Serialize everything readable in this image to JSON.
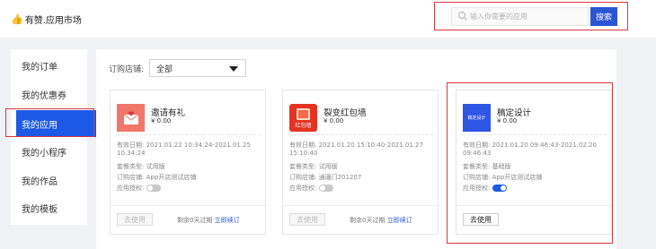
{
  "header": {
    "logo_text": "有赞.应用市场",
    "search_placeholder": "输入你需要的应用",
    "search_button": "搜索"
  },
  "sidebar": {
    "items": [
      {
        "label": "我的订单",
        "active": false
      },
      {
        "label": "我的优惠券",
        "active": false
      },
      {
        "label": "我的应用",
        "active": true
      },
      {
        "label": "我的小程序",
        "active": false
      },
      {
        "label": "我的作品",
        "active": false
      },
      {
        "label": "我的模板",
        "active": false
      }
    ]
  },
  "filter": {
    "label": "订购店铺:",
    "selected": "全部"
  },
  "cards": [
    {
      "name": "邀请有礼",
      "price": "¥ 0.00",
      "valid_label": "有效日期:",
      "valid_value": "2021.01.22 10:34:24-2021.01.25 10:34:24",
      "plan_label": "套餐类型:",
      "plan_value": "试用版",
      "store_label": "订购店铺:",
      "store_value": "App开店测试店铺",
      "auth_label": "应用授权:",
      "auth_on": false,
      "use_button": "去使用",
      "use_enabled": false,
      "remaining": "剩余0天过期",
      "renew": "立即续订",
      "icon_bg": "#f0776a"
    },
    {
      "name": "裂变红包墙",
      "price": "¥ 0.00",
      "valid_label": "有效日期:",
      "valid_value": "2021.01.20 15:10:40-2021.01.27 15:10:40",
      "plan_label": "套餐类型:",
      "plan_value": "试用版",
      "store_label": "订购店铺:",
      "store_value": "通珊门201207",
      "auth_label": "应用授权:",
      "auth_on": false,
      "use_button": "去使用",
      "use_enabled": false,
      "remaining": "剩余0天过期",
      "renew": "立即续订",
      "icon_bg": "#e53321",
      "icon_text": "红包墙"
    },
    {
      "name": "稿定设计",
      "price": "¥ 0.00",
      "valid_label": "有效日期:",
      "valid_value": "2021.01.20 09:46:43-2021.02.20 09:46:43",
      "plan_label": "套餐类型:",
      "plan_value": "基础版",
      "store_label": "订购店铺:",
      "store_value": "App开店测试店铺",
      "auth_label": "应用授权:",
      "auth_on": true,
      "use_button": "去使用",
      "use_enabled": true,
      "remaining": "",
      "renew": "",
      "icon_bg": "#2f55e4",
      "icon_text": "稿定设计"
    }
  ],
  "colors": {
    "accent": "#1b59e6",
    "highlight_outline": "#d9363e",
    "toggle_off": "#c8c8c8",
    "toggle_on": "#1b59e6"
  }
}
